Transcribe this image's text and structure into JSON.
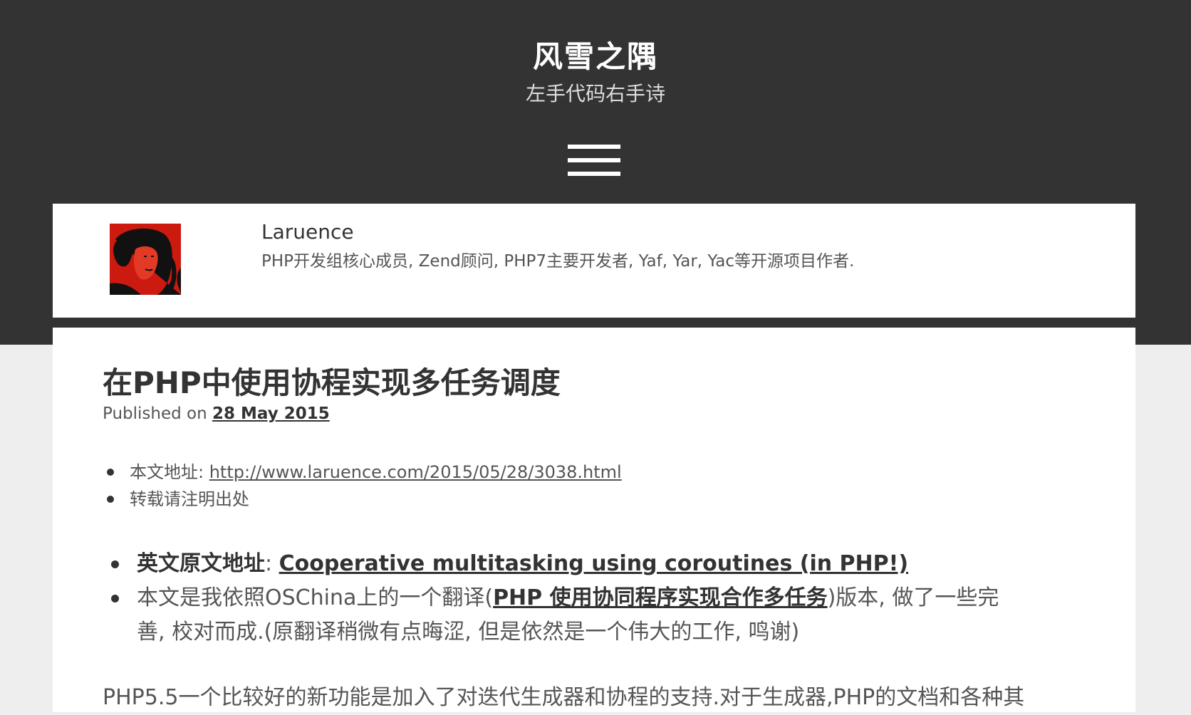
{
  "site": {
    "title": "风雪之隅",
    "subtitle": "左手代码右手诗"
  },
  "menu": {
    "icon": "hamburger-menu-icon"
  },
  "author": {
    "name": "Laruence",
    "bio": "PHP开发组核心成员, Zend顾问, PHP7主要开发者, Yaf, Yar, Yac等开源项目作者.",
    "avatar_colors": {
      "background": "#cc1a10",
      "shadow": "#111111"
    }
  },
  "post": {
    "title": "在PHP中使用协程实现多任务调度",
    "published_prefix": "Published on",
    "published_date": "28 May 2015",
    "notice": {
      "address_label": "本文地址: ",
      "address_url": "http://www.laruence.com/2015/05/28/3038.html",
      "reprint": "转载请注明出处"
    },
    "intro": {
      "original_label": "英文原文地址",
      "original_sep": ": ",
      "original_link": "Cooperative multitasking using coroutines (in PHP!)",
      "version_text_before": "本文是我依照OSChina上的一个翻译(",
      "version_link": "PHP 使用协同程序实现合作多任务",
      "version_text_after": ")版本, 做了一些完善, 校对而成.(原翻译稍微有点晦涩, 但是依然是一个伟大的工作, 鸣谢)"
    },
    "body_first_line": "PHP5.5一个比较好的新功能是加入了对迭代生成器和协程的支持.对于生成器,PHP的文档和各种其"
  },
  "colors": {
    "header_bg": "#333333",
    "page_bg": "#eeeeee",
    "card_bg": "#ffffff",
    "text_dark": "#333333",
    "text_muted": "#555555"
  }
}
